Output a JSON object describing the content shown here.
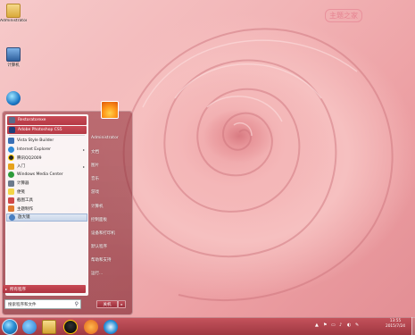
{
  "desktop": {
    "watermark": "主题之家",
    "icons": [
      {
        "label": "Administrator",
        "icon": "folder-icon"
      },
      {
        "label": "计算机",
        "icon": "computer-icon"
      },
      {
        "label": "",
        "icon": "network-icon"
      }
    ]
  },
  "start_menu": {
    "programs": [
      {
        "label": "Restoratorexe",
        "icon": "app-icon",
        "style": "pinned"
      },
      {
        "label": "Adobe Photoshop CS5",
        "icon": "photoshop-icon",
        "style": "pinned"
      },
      {
        "label": "Vista Style Builder",
        "icon": "app-icon"
      },
      {
        "label": "Internet Explorer",
        "icon": "ie-icon",
        "arrow": "▸"
      },
      {
        "label": "腾讯QQ2009",
        "icon": "qq-icon"
      },
      {
        "label": "入门",
        "icon": "start-icon",
        "arrow": "▸"
      },
      {
        "label": "Windows Media Center",
        "icon": "media-center-icon"
      },
      {
        "label": "计算器",
        "icon": "calculator-icon"
      },
      {
        "label": "便笺",
        "icon": "sticky-notes-icon"
      },
      {
        "label": "截图工具",
        "icon": "snipping-tool-icon"
      },
      {
        "label": "主题制作",
        "icon": "theme-icon"
      },
      {
        "label": "放大镜",
        "icon": "magnifier-icon",
        "style": "sel"
      }
    ],
    "all_programs": "所有程序",
    "all_programs_arrow": "▸",
    "search_placeholder": "搜索程序和文件",
    "right_items": [
      "Administrator",
      "文档",
      "图片",
      "音乐",
      "游戏",
      "计算机",
      "控制面板",
      "设备和打印机",
      "默认程序",
      "帮助和支持",
      "运行..."
    ],
    "shutdown_label": "关机",
    "shutdown_arrow": "▸"
  },
  "taskbar": {
    "pinned": [
      "ie-icon",
      "explorer-icon",
      "qq-icon",
      "media-player-icon",
      "browser-icon"
    ],
    "tray_icons": [
      "▲",
      "⚑",
      "▭",
      "♪",
      "◐",
      "✎"
    ],
    "time": "13:55",
    "date": "2015/7/24"
  },
  "colors": {
    "accent": "#b53a46",
    "taskbar": "#a83a47"
  }
}
